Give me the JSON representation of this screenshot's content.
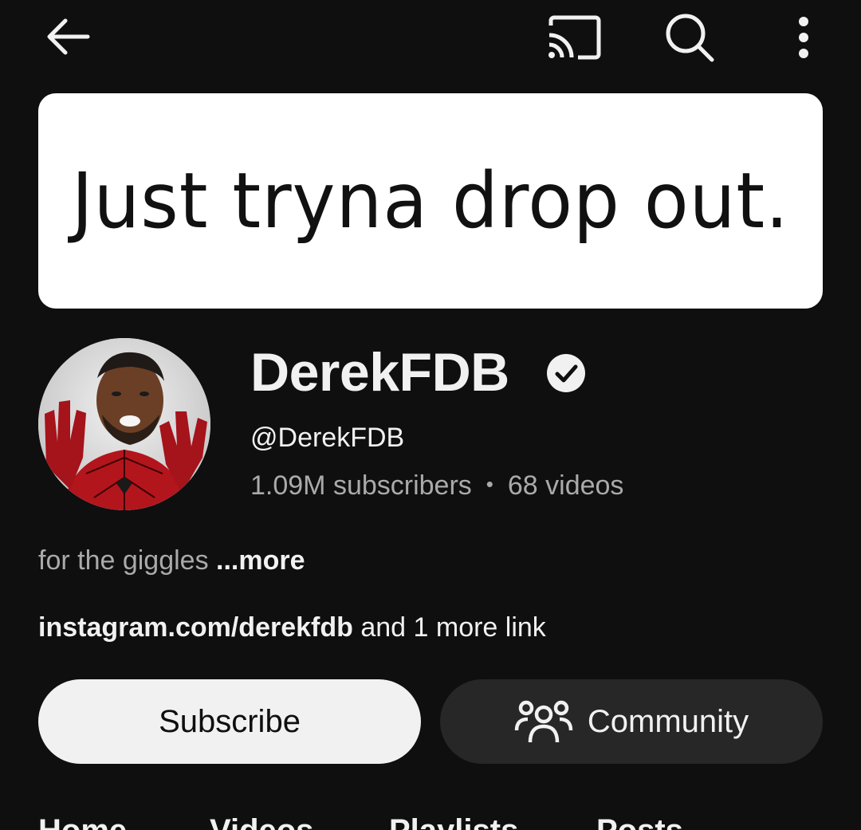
{
  "topbar": {
    "back_icon": "arrow-back-icon",
    "cast_icon": "cast-icon",
    "search_icon": "search-icon",
    "more_icon": "more-vert-icon"
  },
  "banner": {
    "text": "Just tryna drop out."
  },
  "channel": {
    "name": "DerekFDB",
    "handle": "@DerekFDB",
    "subscribers": "1.09M subscribers",
    "separator": "•",
    "videos": "68 videos",
    "description": "for the giggles ",
    "description_more": "...more",
    "link_primary": "instagram.com/derekfdb",
    "link_more": " and 1 more link"
  },
  "actions": {
    "subscribe_label": "Subscribe",
    "community_label": "Community"
  },
  "tabs": [
    "Home",
    "Videos",
    "Playlists",
    "Posts"
  ],
  "colors": {
    "background": "#0f0f0f",
    "text_primary": "#f1f1f1",
    "text_secondary": "#aaaaaa",
    "subscribe_bg": "#f1f1f1",
    "community_bg": "#272727"
  }
}
